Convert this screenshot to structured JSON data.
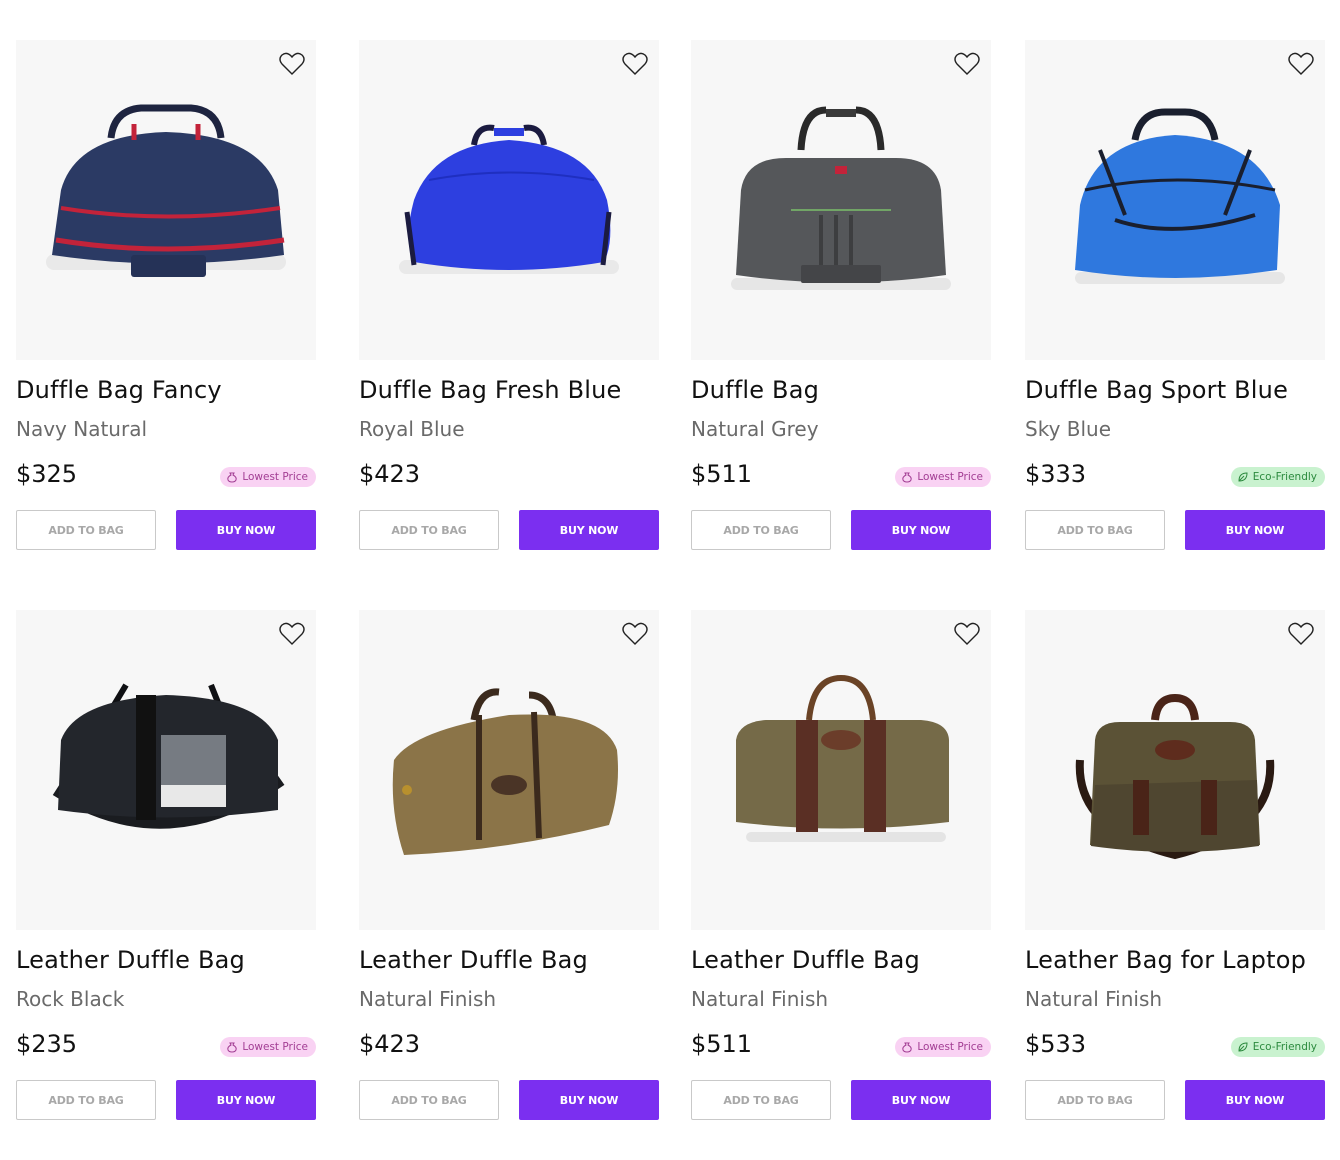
{
  "colors": {
    "accent": "#7b2ff0",
    "lowest_bg": "#f9d2f3",
    "lowest_fg": "#a23d93",
    "eco_bg": "#c9f2cf",
    "eco_fg": "#2c8a3e"
  },
  "products": [
    {
      "title": "Duffle Bag Fancy",
      "variant": "Navy Natural",
      "price": "$325",
      "badge": "Lowest Price",
      "badge_type": "lowest",
      "add_label": "ADD TO BAG",
      "buy_label": "BUY NOW",
      "bag_color": "#2b3a64",
      "trim_color": "#c3233a",
      "style": "sport"
    },
    {
      "title": "Duffle Bag Fresh Blue",
      "variant": "Royal Blue",
      "price": "$423",
      "badge": "",
      "badge_type": "",
      "add_label": "ADD TO BAG",
      "buy_label": "BUY NOW",
      "bag_color": "#2d3fe0",
      "trim_color": "#1b1b40",
      "style": "sport"
    },
    {
      "title": "Duffle Bag",
      "variant": "Natural Grey",
      "price": "$511",
      "badge": "Lowest Price",
      "badge_type": "lowest",
      "add_label": "ADD TO BAG",
      "buy_label": "BUY NOW",
      "bag_color": "#55575a",
      "trim_color": "#2a2a2a",
      "style": "sport"
    },
    {
      "title": "Duffle Bag Sport Blue",
      "variant": "Sky Blue",
      "price": "$333",
      "badge": "Eco-Friendly",
      "badge_type": "eco",
      "add_label": "ADD TO BAG",
      "buy_label": "BUY NOW",
      "bag_color": "#2f78de",
      "trim_color": "#1a1f2e",
      "style": "sport"
    },
    {
      "title": "Leather Duffle Bag",
      "variant": "Rock Black",
      "price": "$235",
      "badge": "Lowest Price",
      "badge_type": "lowest",
      "add_label": "ADD TO BAG",
      "buy_label": "BUY NOW",
      "bag_color": "#23262c",
      "trim_color": "#0f1013",
      "style": "sling"
    },
    {
      "title": "Leather Duffle Bag",
      "variant": "Natural Finish",
      "price": "$423",
      "badge": "",
      "badge_type": "",
      "add_label": "ADD TO BAG",
      "buy_label": "BUY NOW",
      "bag_color": "#8b7448",
      "trim_color": "#3b2a1d",
      "style": "sling"
    },
    {
      "title": "Leather Duffle Bag",
      "variant": "Natural Finish",
      "price": "$511",
      "badge": "Lowest Price",
      "badge_type": "lowest",
      "add_label": "ADD TO BAG",
      "buy_label": "BUY NOW",
      "bag_color": "#756a48",
      "trim_color": "#5a2f24",
      "style": "barrel"
    },
    {
      "title": "Leather Bag for Laptop",
      "variant": "Natural Finish",
      "price": "$533",
      "badge": "Eco-Friendly",
      "badge_type": "eco",
      "add_label": "ADD TO BAG",
      "buy_label": "BUY NOW",
      "bag_color": "#5b5236",
      "trim_color": "#4a2418",
      "style": "messenger"
    }
  ]
}
